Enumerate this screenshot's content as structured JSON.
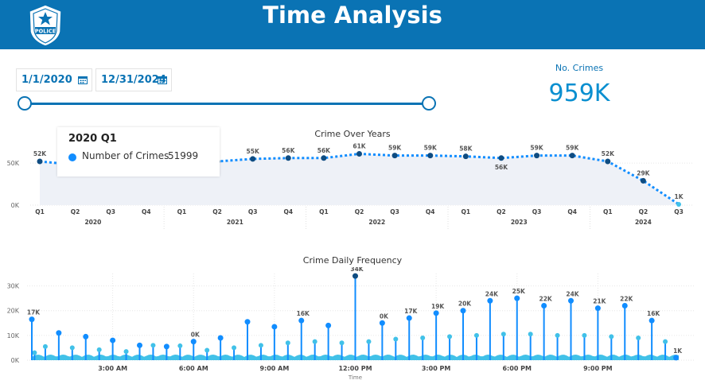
{
  "header": {
    "title": "Time Analysis",
    "badge_text": "POLICE"
  },
  "filters": {
    "start_date": "1/1/2020",
    "end_date": "12/31/2024"
  },
  "kpi": {
    "label": "No. Crimes",
    "value": "959K"
  },
  "colors": {
    "brand": "#0a73b4",
    "accent": "#118dff",
    "dark_point": "#0f4c81",
    "light_point": "#41c1e8"
  },
  "tooltip": {
    "title": "2020 Q1",
    "series_label": "Number of Crimes",
    "value": "51999"
  },
  "chart_data": [
    {
      "type": "line",
      "title": "Crime Over Years",
      "ylim": [
        0,
        70000
      ],
      "yticks": [
        {
          "value": 0,
          "label": "0K"
        },
        {
          "value": 50000,
          "label": "50K"
        }
      ],
      "categories": [
        "Q1",
        "Q2",
        "Q3",
        "Q4",
        "Q1",
        "Q2",
        "Q3",
        "Q4",
        "Q1",
        "Q2",
        "Q3",
        "Q4",
        "Q1",
        "Q2",
        "Q3",
        "Q4",
        "Q1",
        "Q2",
        "Q3"
      ],
      "years": [
        {
          "label": "2020",
          "start": 0,
          "end": 3
        },
        {
          "label": "2021",
          "start": 4,
          "end": 7
        },
        {
          "label": "2022",
          "start": 8,
          "end": 11
        },
        {
          "label": "2023",
          "start": 12,
          "end": 15
        },
        {
          "label": "2024",
          "start": 16,
          "end": 18
        }
      ],
      "values": [
        51999,
        48000,
        45000,
        48000,
        50000,
        52000,
        55000,
        56000,
        56000,
        61000,
        59000,
        59000,
        58000,
        56000,
        59000,
        59000,
        52000,
        29000,
        1000
      ],
      "labels": [
        "52K",
        "",
        "",
        "48K",
        "",
        "K",
        "55K",
        "56K",
        "56K",
        "61K",
        "59K",
        "59K",
        "58K",
        "56K",
        "59K",
        "59K",
        "52K",
        "29K",
        "1K"
      ],
      "label_below": [
        false,
        false,
        false,
        true,
        false,
        false,
        false,
        false,
        false,
        false,
        false,
        false,
        false,
        true,
        false,
        false,
        false,
        false,
        false
      ],
      "highlight": 0,
      "area": true,
      "line_style": "dotted",
      "grid": true
    },
    {
      "type": "lollipop",
      "title": "Crime Daily Frequency",
      "xlabel": "Time",
      "ylim": [
        0,
        35000
      ],
      "yticks": [
        {
          "value": 0,
          "label": "0K"
        },
        {
          "value": 10000,
          "label": "10K"
        },
        {
          "value": 20000,
          "label": "20K"
        },
        {
          "value": 30000,
          "label": "30K"
        }
      ],
      "xticks": [
        {
          "hour": 3,
          "label": "3:00 AM"
        },
        {
          "hour": 6,
          "label": "6:00 AM"
        },
        {
          "hour": 9,
          "label": "9:00 AM"
        },
        {
          "hour": 12,
          "label": "12:00 PM"
        },
        {
          "hour": 15,
          "label": "3:00 PM"
        },
        {
          "hour": 18,
          "label": "6:00 PM"
        },
        {
          "hour": 21,
          "label": "9:00 PM"
        }
      ],
      "x_range": [
        0,
        24
      ],
      "hourly": [
        {
          "hour": 0,
          "value": 16500,
          "label": "17K"
        },
        {
          "hour": 1,
          "value": 11000,
          "label": ""
        },
        {
          "hour": 2,
          "value": 9500,
          "label": ""
        },
        {
          "hour": 3,
          "value": 8000,
          "label": ""
        },
        {
          "hour": 4,
          "value": 6000,
          "label": ""
        },
        {
          "hour": 5,
          "value": 5500,
          "label": ""
        },
        {
          "hour": 6,
          "value": 7500,
          "label": "0K"
        },
        {
          "hour": 7,
          "value": 9000,
          "label": ""
        },
        {
          "hour": 8,
          "value": 15500,
          "label": ""
        },
        {
          "hour": 9,
          "value": 13500,
          "label": ""
        },
        {
          "hour": 10,
          "value": 16000,
          "label": "16K"
        },
        {
          "hour": 11,
          "value": 14000,
          "label": ""
        },
        {
          "hour": 12,
          "value": 34000,
          "label": "34K"
        },
        {
          "hour": 13,
          "value": 15000,
          "label": "0K"
        },
        {
          "hour": 14,
          "value": 17000,
          "label": "17K"
        },
        {
          "hour": 15,
          "value": 19000,
          "label": "19K"
        },
        {
          "hour": 16,
          "value": 20000,
          "label": "20K"
        },
        {
          "hour": 17,
          "value": 24000,
          "label": "24K"
        },
        {
          "hour": 18,
          "value": 25000,
          "label": "25K"
        },
        {
          "hour": 19,
          "value": 22000,
          "label": "22K"
        },
        {
          "hour": 20,
          "value": 24000,
          "label": "24K"
        },
        {
          "hour": 21,
          "value": 21000,
          "label": "21K"
        },
        {
          "hour": 22,
          "value": 22000,
          "label": "22K"
        },
        {
          "hour": 23,
          "value": 16000,
          "label": "16K"
        },
        {
          "hour": 23.9,
          "value": 1000,
          "label": "1K"
        }
      ],
      "minor": [
        {
          "hour": 0.1,
          "value": 3000
        },
        {
          "hour": 0.5,
          "value": 5500
        },
        {
          "hour": 1.5,
          "value": 5000
        },
        {
          "hour": 2.5,
          "value": 4200
        },
        {
          "hour": 3.5,
          "value": 3500
        },
        {
          "hour": 4.5,
          "value": 6000
        },
        {
          "hour": 5.5,
          "value": 5800
        },
        {
          "hour": 6.5,
          "value": 4000
        },
        {
          "hour": 7.5,
          "value": 5000
        },
        {
          "hour": 8.5,
          "value": 6000
        },
        {
          "hour": 9.5,
          "value": 7000
        },
        {
          "hour": 10.5,
          "value": 7500
        },
        {
          "hour": 11.5,
          "value": 7000
        },
        {
          "hour": 12.5,
          "value": 7500
        },
        {
          "hour": 13.5,
          "value": 8500
        },
        {
          "hour": 14.5,
          "value": 9000
        },
        {
          "hour": 15.5,
          "value": 9500
        },
        {
          "hour": 16.5,
          "value": 10000
        },
        {
          "hour": 17.5,
          "value": 10500
        },
        {
          "hour": 18.5,
          "value": 10500
        },
        {
          "hour": 19.5,
          "value": 10000
        },
        {
          "hour": 20.5,
          "value": 10000
        },
        {
          "hour": 21.5,
          "value": 9500
        },
        {
          "hour": 22.5,
          "value": 9000
        },
        {
          "hour": 23.5,
          "value": 7500
        }
      ],
      "grid": true
    }
  ]
}
